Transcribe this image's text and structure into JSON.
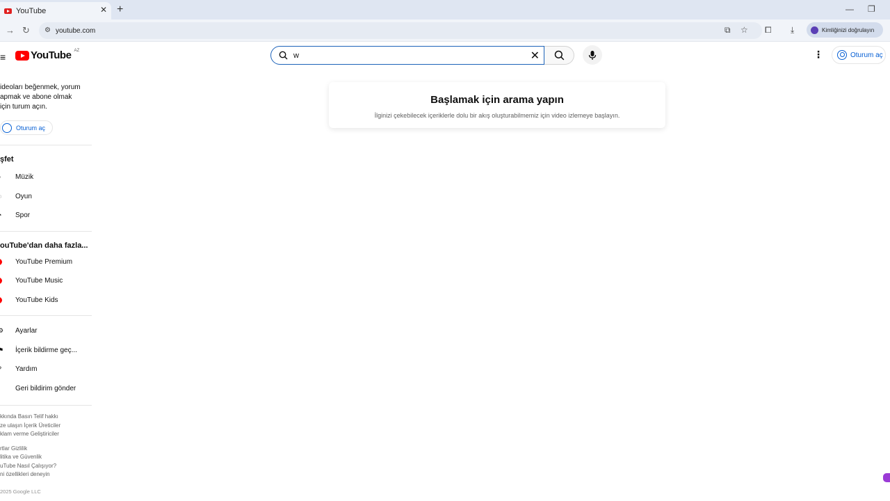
{
  "browser": {
    "tab_title": "YouTube",
    "tab_close": "✕",
    "new_tab": "+",
    "url": "youtube.com",
    "profile_label": "Kimliğinizi doğrulayın",
    "minimize": "—",
    "restore": "❐"
  },
  "header": {
    "logo_text": "YouTube",
    "country_code": "AZ",
    "search_value": "w",
    "signin_label": "Oturum aç"
  },
  "sidebar": {
    "signin_prompt": "ideoları beğenmek, yorum apmak ve abone olmak için turum açın.",
    "signin_button": "Oturum aç",
    "explore_heading": "şfet",
    "explore_items": [
      {
        "label": "Müzik",
        "icon": "music-icon"
      },
      {
        "label": "Oyun",
        "icon": "gaming-icon"
      },
      {
        "label": "Spor",
        "icon": "sports-icon"
      }
    ],
    "more_heading": "ouTube'dan daha fazla...",
    "more_items": [
      {
        "label": "YouTube Premium",
        "icon": "youtube-premium-icon"
      },
      {
        "label": "YouTube Music",
        "icon": "youtube-music-icon"
      },
      {
        "label": "YouTube Kids",
        "icon": "youtube-kids-icon"
      }
    ],
    "settings_items": [
      {
        "label": "Ayarlar",
        "icon": "gear-icon"
      },
      {
        "label": "İçerik bildirme geç...",
        "icon": "flag-icon"
      },
      {
        "label": "Yardım",
        "icon": "help-icon"
      },
      {
        "label": "Geri bildirim gönder",
        "icon": "feedback-icon"
      }
    ],
    "footer_line1": "kkında  Basın  Telif hakkı",
    "footer_line2": "ze ulaşın  İçerik Üreticiler",
    "footer_line3": "klam verme  Geliştiriciler",
    "footer_line4": "rtlar  Gizlilik",
    "footer_line5": "litika ve Güvenlik",
    "footer_line6": "uTube Nasıl Çalışıyor?",
    "footer_line7": "ni özellikleri deneyin",
    "copyright": "2025 Google LLC"
  },
  "main": {
    "card_title": "Başlamak için arama yapın",
    "card_subtitle": "İlginizi çekebilecek içeriklerle dolu bir akış oluşturabilmemiz için video izlemeye başlayın."
  },
  "colors": {
    "brand_red": "#ff0000",
    "link_blue": "#065fd4",
    "search_focus": "#1c62b9"
  }
}
